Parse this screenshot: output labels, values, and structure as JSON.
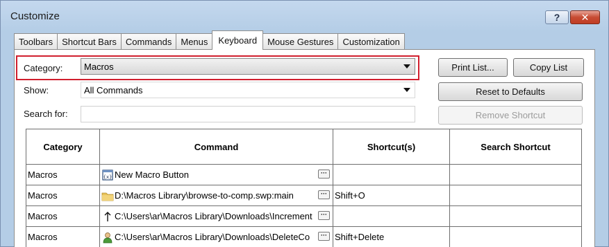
{
  "window": {
    "title": "Customize"
  },
  "titlebar": {
    "help_label": "?",
    "close_label": "✕"
  },
  "tabs": [
    {
      "label": "Toolbars",
      "active": false
    },
    {
      "label": "Shortcut Bars",
      "active": false
    },
    {
      "label": "Commands",
      "active": false
    },
    {
      "label": "Menus",
      "active": false
    },
    {
      "label": "Keyboard",
      "active": true
    },
    {
      "label": "Mouse Gestures",
      "active": false
    },
    {
      "label": "Customization",
      "active": false
    }
  ],
  "form": {
    "category_label": "Category:",
    "category_value": "Macros",
    "show_label": "Show:",
    "show_value": "All Commands",
    "search_label": "Search for:",
    "search_value": ""
  },
  "buttons": {
    "print_list": "Print List...",
    "copy_list": "Copy List",
    "reset_defaults": "Reset to Defaults",
    "remove_shortcut": "Remove Shortcut"
  },
  "table": {
    "headers": [
      "Category",
      "Command",
      "Shortcut(s)",
      "Search Shortcut"
    ],
    "rows": [
      {
        "category": "Macros",
        "icon": "macro-button-icon",
        "command": "New Macro Button",
        "shortcut": "",
        "search_shortcut": ""
      },
      {
        "category": "Macros",
        "icon": "folder-icon",
        "command": "D:\\Macros Library\\browse-to-comp.swp:main",
        "shortcut": "Shift+O",
        "search_shortcut": ""
      },
      {
        "category": "Macros",
        "icon": "arrow-up-icon",
        "command": "C:\\Users\\ar\\Macros Library\\Downloads\\Increment",
        "shortcut": "",
        "search_shortcut": ""
      },
      {
        "category": "Macros",
        "icon": "person-icon",
        "command": "C:\\Users\\ar\\Macros Library\\Downloads\\DeleteCo",
        "shortcut": "Shift+Delete",
        "search_shortcut": ""
      }
    ]
  },
  "colors": {
    "highlight": "#d11f2e",
    "window_bg": "#b4cde6",
    "close_button": "#c13d24"
  }
}
